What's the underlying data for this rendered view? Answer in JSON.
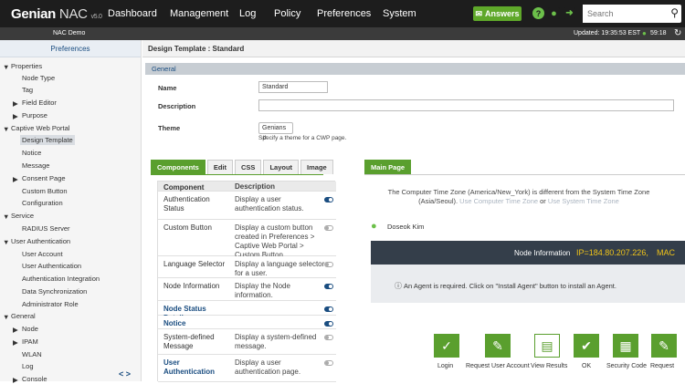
{
  "app": {
    "logo_main": "Genian",
    "logo_sub": "NAC",
    "version": "v5.0"
  },
  "nav": {
    "dashboard": "Dashboard",
    "management": "Management",
    "log": "Log",
    "policy": "Policy",
    "preferences": "Preferences",
    "system": "System",
    "answers": "Answers"
  },
  "search": {
    "placeholder": "Search"
  },
  "subbar": {
    "site": "NAC Demo",
    "updated": "Updated: 19:35:53 EST",
    "timer": "59:18"
  },
  "sidebar": {
    "title": "Preferences",
    "items": [
      {
        "label": "Properties"
      },
      {
        "label": "Node Type"
      },
      {
        "label": "Tag"
      },
      {
        "label": "Field Editor"
      },
      {
        "label": "Purpose"
      },
      {
        "label": "Captive Web Portal"
      },
      {
        "label": "Design Template"
      },
      {
        "label": "Notice"
      },
      {
        "label": "Message"
      },
      {
        "label": "Consent Page"
      },
      {
        "label": "Custom Button"
      },
      {
        "label": "Configuration"
      },
      {
        "label": "Service"
      },
      {
        "label": "RADIUS Server"
      },
      {
        "label": "User Authentication"
      },
      {
        "label": "User Account"
      },
      {
        "label": "User Authentication"
      },
      {
        "label": "Authentication Integration"
      },
      {
        "label": "Data Synchronization"
      },
      {
        "label": "Administrator Role"
      },
      {
        "label": "General"
      },
      {
        "label": "Node"
      },
      {
        "label": "IPAM"
      },
      {
        "label": "WLAN"
      },
      {
        "label": "Log"
      },
      {
        "label": "Console"
      }
    ]
  },
  "page": {
    "title": "Design Template : Standard",
    "section": "General"
  },
  "form": {
    "name_label": "Name",
    "name_value": "Standard",
    "description_label": "Description",
    "description_value": "",
    "theme_label": "Theme",
    "theme_value": "Genians",
    "theme_hint": "Specify a theme for a CWP page."
  },
  "tabs": [
    "Components",
    "Edit",
    "CSS",
    "Layout",
    "Image"
  ],
  "preview_tab": "Main Page",
  "components": {
    "header_component": "Component",
    "header_description": "Description",
    "rows": [
      {
        "component": "Authentication Status",
        "description": "Display a user authentication status.",
        "on": true
      },
      {
        "component": "Custom Button",
        "description": "Display a custom button created in Preferences > Captive Web Portal > Custom Button.",
        "on": false
      },
      {
        "component": "Language Selector",
        "description": "Display a language selector for a user.",
        "on": false
      },
      {
        "component": "Node Information",
        "description": "Display the Node information.",
        "on": true
      },
      {
        "component": "Node Status Details",
        "description": "",
        "on": true
      },
      {
        "component": "Notice",
        "description": "",
        "on": true
      },
      {
        "component": "System-defined Message",
        "description": "Display a system-defined message.",
        "on": false
      },
      {
        "component": "User Authentication",
        "description": "Display a user authentication page.",
        "on": false
      }
    ]
  },
  "preview": {
    "tz_line1": "The Computer Time Zone (America/New_York) is different from the System Time Zone",
    "tz_line2_prefix": "(Asia/Seoul).",
    "tz_link1": "Use Computer Time Zone",
    "tz_or": "or",
    "tz_link2": "Use System Time Zone",
    "user": "Doseok Kim",
    "node_info_label": "Node Information",
    "node_ip": "IP=184.80.207.226,",
    "node_mac": "MAC",
    "agent_msg": "An Agent is required. Click on \"Install Agent\" button to install an Agent.",
    "buttons": [
      "Login",
      "Request User Account",
      "View Results",
      "OK",
      "Security Code",
      "Request"
    ]
  }
}
